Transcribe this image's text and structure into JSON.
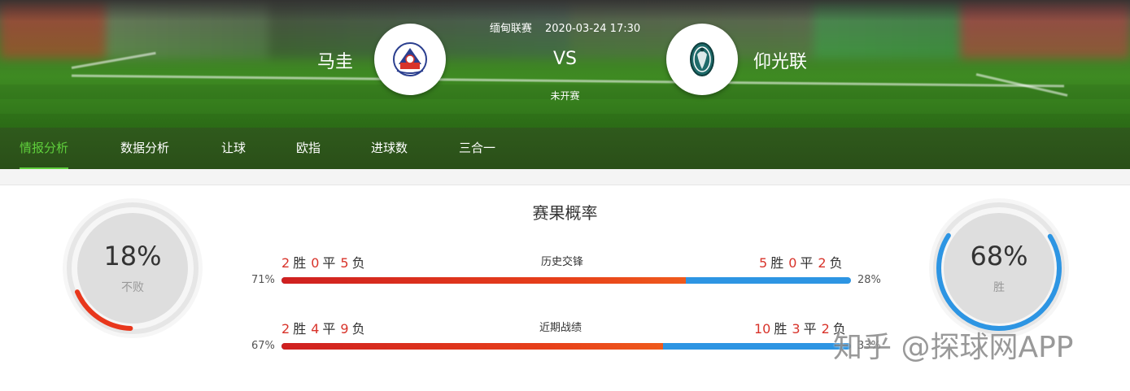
{
  "match": {
    "league": "缅甸联赛",
    "datetime": "2020-03-24 17:30",
    "vs": "VS",
    "status": "未开赛",
    "home": {
      "name": "马圭",
      "logo": "madgway-club-crest-icon"
    },
    "away": {
      "name": "仰光联",
      "logo": "yangon-united-crest-icon"
    }
  },
  "nav": {
    "items": [
      {
        "label": "情报分析",
        "active": true
      },
      {
        "label": "数据分析",
        "active": false
      },
      {
        "label": "让球",
        "active": false
      },
      {
        "label": "欧指",
        "active": false
      },
      {
        "label": "进球数",
        "active": false
      },
      {
        "label": "三合一",
        "active": false
      }
    ]
  },
  "probability": {
    "title": "赛果概率",
    "home": {
      "percent": "18%",
      "label": "不败",
      "value": 0.18,
      "color": "#e8371c"
    },
    "away": {
      "percent": "68%",
      "label": "胜",
      "value": 0.68,
      "color": "#2d95e3"
    },
    "track_color": "#e6e6e6"
  },
  "rows": [
    {
      "label": "历史交锋",
      "home": {
        "w": "2",
        "d": "0",
        "l": "5",
        "pct": "71%",
        "ratio": 0.71
      },
      "away": {
        "w": "5",
        "d": "0",
        "l": "2",
        "pct": "28%"
      },
      "words": {
        "w": "胜",
        "d": "平",
        "l": "负"
      }
    },
    {
      "label": "近期战绩",
      "home": {
        "w": "2",
        "d": "4",
        "l": "9",
        "pct": "67%",
        "ratio": 0.67
      },
      "away": {
        "w": "10",
        "d": "3",
        "l": "2",
        "pct": "33%"
      },
      "words": {
        "w": "胜",
        "d": "平",
        "l": "负"
      }
    }
  ],
  "watermark": "知乎 @探球网APP",
  "colors": {
    "accent_green": "#5fcf3c",
    "home_red": "#d8332a",
    "away_blue": "#2d95e3"
  }
}
